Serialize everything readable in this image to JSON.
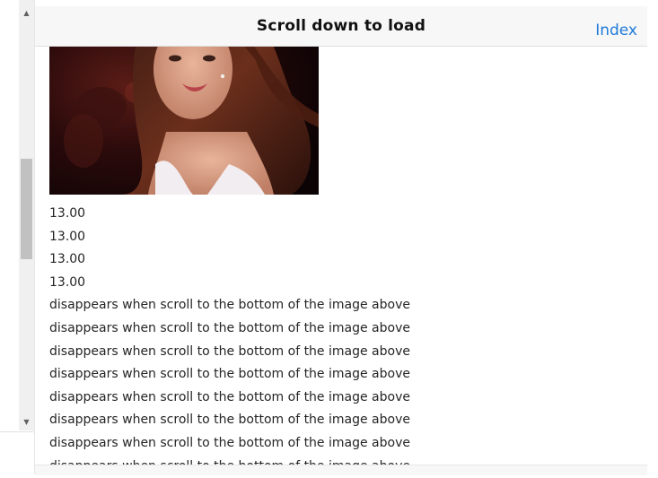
{
  "header": {
    "title": "Scroll down to load",
    "index_link": "Index"
  },
  "values": [
    "13.00",
    "13.00",
    "13.00",
    "13.00"
  ],
  "messages": [
    "disappears when scroll to the bottom of the image above",
    "disappears when scroll to the bottom of the image above",
    "disappears when scroll to the bottom of the image above",
    "disappears when scroll to the bottom of the image above",
    "disappears when scroll to the bottom of the image above",
    "disappears when scroll to the bottom of the image above",
    "disappears when scroll to the bottom of the image above",
    "disappears when scroll to the bottom of the image above"
  ],
  "colors": {
    "link": "#1e7ad9",
    "header_bg": "#f7f7f7",
    "scroll_thumb": "#c1c1c1"
  }
}
